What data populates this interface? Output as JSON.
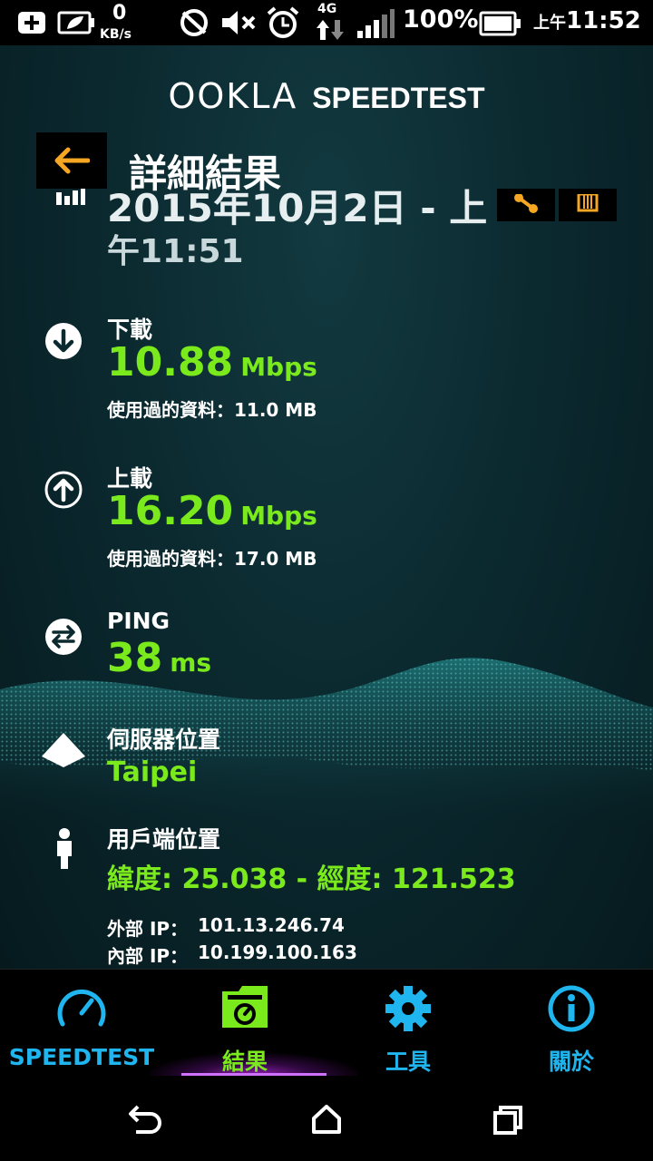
{
  "status_bar": {
    "net_speed_value": "0",
    "net_speed_unit": "KB/s",
    "network_type": "4G",
    "battery_percent": "100%",
    "time_ampm": "上午",
    "time": "11:52",
    "icons": [
      "add-icon",
      "battery-saver-icon",
      "data-sync-icon",
      "mute-icon",
      "alarm-icon",
      "network-arrows-icon",
      "signal-icon",
      "battery-icon"
    ]
  },
  "app": {
    "logo_ookla": "OOKLA",
    "logo_speedtest": "SPEEDTEST",
    "header": {
      "title": "詳細結果"
    },
    "result": {
      "date_line1": "2015年10月2日 - 上",
      "date_line2": "午11:51",
      "download": {
        "label": "下載",
        "value": "10.88",
        "unit": "Mbps",
        "data_used": "使用過的資料：11.0 MB"
      },
      "upload": {
        "label": "上載",
        "value": "16.20",
        "unit": "Mbps",
        "data_used": "使用過的資料：17.0 MB"
      },
      "ping": {
        "label": "PING",
        "value": "38",
        "unit": "ms"
      },
      "server": {
        "label": "伺服器位置",
        "value": "Taipei"
      },
      "client": {
        "label": "用戶端位置",
        "coords": "緯度: 25.038 - 經度: 121.523",
        "external_ip_label": "外部 IP：",
        "external_ip": "101.13.246.74",
        "internal_ip_label": "內部 IP：",
        "internal_ip": "10.199.100.163"
      }
    }
  },
  "bottom_nav": {
    "tabs": [
      {
        "label": "SPEEDTEST",
        "icon": "speedometer-icon",
        "color": "#1fb6f0"
      },
      {
        "label": "結果",
        "icon": "results-folder-icon",
        "color": "#7bea1d",
        "active": true
      },
      {
        "label": "工具",
        "icon": "gear-icon",
        "color": "#1fb6f0"
      },
      {
        "label": "關於",
        "icon": "info-icon",
        "color": "#1fb6f0"
      }
    ]
  },
  "system_nav": {
    "buttons": [
      "back-icon",
      "home-icon",
      "recents-icon"
    ]
  },
  "colors": {
    "accent_green": "#7bea1d",
    "accent_blue": "#1fb6f0",
    "accent_orange": "#f5a623",
    "background": "#0b2a30"
  }
}
